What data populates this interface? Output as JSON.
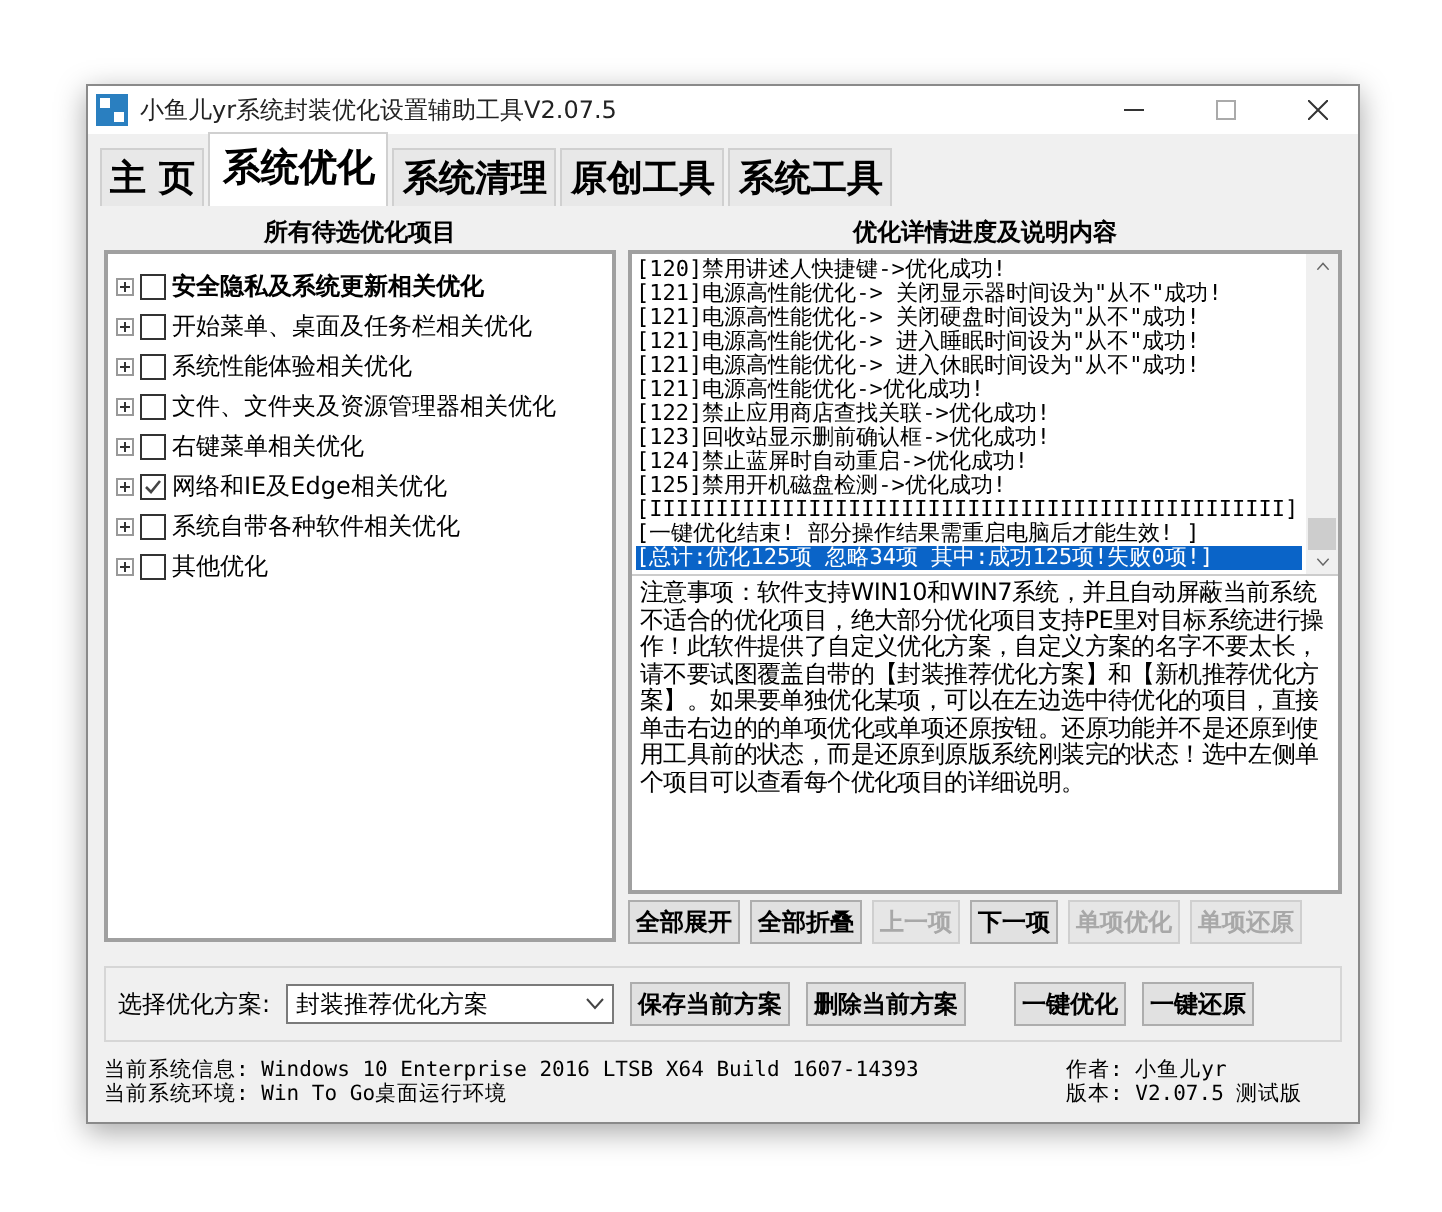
{
  "window": {
    "title": "小鱼儿yr系统封装优化设置辅助工具V2.07.5"
  },
  "tabs": [
    {
      "label": "主 页",
      "selected": false
    },
    {
      "label": "系统优化",
      "selected": true
    },
    {
      "label": "系统清理",
      "selected": false
    },
    {
      "label": "原创工具",
      "selected": false
    },
    {
      "label": "系统工具",
      "selected": false
    }
  ],
  "left_panel": {
    "heading": "所有待选优化项目",
    "tree": [
      {
        "label": "安全隐私及系统更新相关优化",
        "checked": false,
        "selected": true
      },
      {
        "label": "开始菜单、桌面及任务栏相关优化",
        "checked": false,
        "selected": false
      },
      {
        "label": "系统性能体验相关优化",
        "checked": false,
        "selected": false
      },
      {
        "label": "文件、文件夹及资源管理器相关优化",
        "checked": false,
        "selected": false
      },
      {
        "label": "右键菜单相关优化",
        "checked": false,
        "selected": false
      },
      {
        "label": "网络和IE及Edge相关优化",
        "checked": true,
        "selected": false
      },
      {
        "label": "系统自带各种软件相关优化",
        "checked": false,
        "selected": false
      },
      {
        "label": "其他优化",
        "checked": false,
        "selected": false
      }
    ]
  },
  "right_panel": {
    "heading": "优化详情进度及说明内容",
    "log": [
      {
        "text": "[120]禁用讲述人快捷键->优化成功!",
        "selected": false
      },
      {
        "text": "[121]电源高性能优化-> 关闭显示器时间设为\"从不\"成功!",
        "selected": false
      },
      {
        "text": "[121]电源高性能优化-> 关闭硬盘时间设为\"从不\"成功!",
        "selected": false
      },
      {
        "text": "[121]电源高性能优化-> 进入睡眠时间设为\"从不\"成功!",
        "selected": false
      },
      {
        "text": "[121]电源高性能优化-> 进入休眠时间设为\"从不\"成功!",
        "selected": false
      },
      {
        "text": "[121]电源高性能优化->优化成功!",
        "selected": false
      },
      {
        "text": "[122]禁止应用商店查找关联->优化成功!",
        "selected": false
      },
      {
        "text": "[123]回收站显示删前确认框->优化成功!",
        "selected": false
      },
      {
        "text": "[124]禁止蓝屏时自动重启->优化成功!",
        "selected": false
      },
      {
        "text": "[125]禁用开机磁盘检测->优化成功!",
        "selected": false
      },
      {
        "text": "[IIIIIIIIIIIIIIIIIIIIIIIIIIIIIIIIIIIIIIIIIIIIIIII]",
        "selected": false
      },
      {
        "text": "[一键优化结束! 部分操作结果需重启电脑后才能生效! ]",
        "selected": false
      },
      {
        "text": "[总计:优化125项 忽略34项 其中:成功125项!失败0项!]",
        "selected": true
      }
    ],
    "notes": "注意事项：软件支持WIN10和WIN7系统，并且自动屏蔽当前系统不适合的优化项目，绝大部分优化项目支持PE里对目标系统进行操作！此软件提供了自定义优化方案，自定义方案的名字不要太长，请不要试图覆盖自带的【封装推荐优化方案】和【新机推荐优化方案】。如果要单独优化某项，可以在左边选中待优化的项目，直接单击右边的的单项优化或单项还原按钮。还原功能并不是还原到使用工具前的状态，而是还原到原版系统刚装完的状态！选中左侧单个项目可以查看每个优化项目的详细说明。"
  },
  "panel_buttons": [
    {
      "label": "全部展开",
      "disabled": false
    },
    {
      "label": "全部折叠",
      "disabled": false
    },
    {
      "label": "上一项",
      "disabled": true
    },
    {
      "label": "下一项",
      "disabled": false
    },
    {
      "label": "单项优化",
      "disabled": true
    },
    {
      "label": "单项还原",
      "disabled": true
    }
  ],
  "scheme": {
    "label": "选择优化方案:",
    "value": "封装推荐优化方案"
  },
  "scheme_buttons": [
    "保存当前方案",
    "删除当前方案"
  ],
  "action_buttons": [
    "一键优化",
    "一键还原"
  ],
  "status": {
    "system_info": "当前系统信息: Windows 10 Enterprise 2016 LTSB X64 Build 1607-14393",
    "environment": "当前系统环境: Win To Go桌面运行环境",
    "author": "作者: 小鱼儿yr",
    "version": "版本: V2.07.5 测试版"
  }
}
